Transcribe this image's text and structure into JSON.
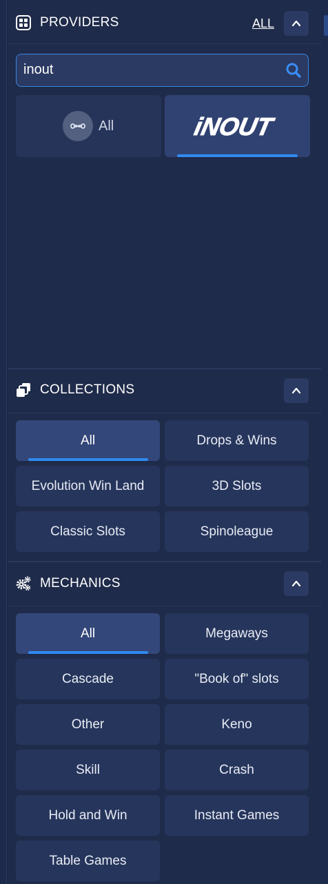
{
  "providers": {
    "title": "PROVIDERS",
    "all_link": "ALL",
    "search_value": "inout",
    "cards": [
      {
        "label": "All",
        "icon": "infinity-icon",
        "selected": false
      },
      {
        "label": "INOUT",
        "icon": "inout-logo",
        "selected": true
      }
    ]
  },
  "collections": {
    "title": "COLLECTIONS",
    "items": [
      "All",
      "Drops & Wins",
      "Evolution Win Land",
      "3D Slots",
      "Classic Slots",
      "Spinoleague"
    ],
    "active_index": 0
  },
  "mechanics": {
    "title": "MECHANICS",
    "items": [
      "All",
      "Megaways",
      "Cascade",
      "\"Book of\" slots",
      "Other",
      "Keno",
      "Skill",
      "Crash",
      "Hold and Win",
      "Instant Games",
      "Table Games"
    ],
    "active_index": 0
  },
  "colors": {
    "background": "#1a2440",
    "panel": "#1f2b4a",
    "chip": "#26355b",
    "chip_active": "#34477a",
    "accent": "#2f8af1"
  }
}
